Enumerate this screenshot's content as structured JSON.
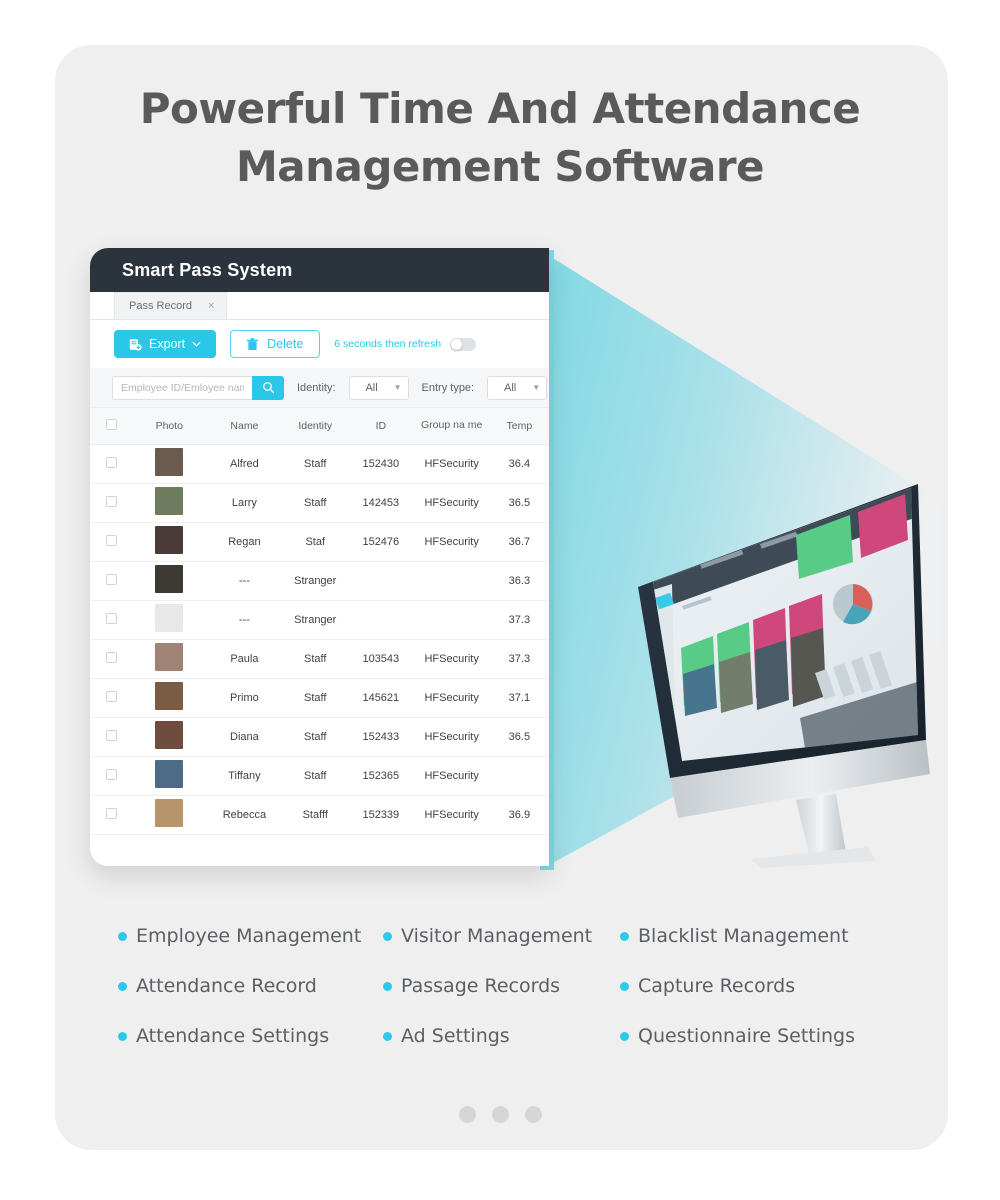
{
  "heading": {
    "line1": "Powerful Time And Attendance",
    "line2": "Management Software"
  },
  "app": {
    "title": "Smart Pass System",
    "tab": {
      "label": "Pass Record",
      "close": "×"
    },
    "toolbar": {
      "export_label": "Export",
      "export_caret": "∨",
      "delete_label": "Delete",
      "refresh_text": "6 seconds then refresh"
    },
    "filters": {
      "search_placeholder": "Employee ID/Emloyee nam",
      "identity_label": "Identity:",
      "identity_value": "All",
      "entry_label": "Entry type:",
      "entry_value": "All"
    },
    "table": {
      "columns": [
        "",
        "Photo",
        "Name",
        "Identity",
        "ID",
        "Group na me",
        "Temp"
      ],
      "rows": [
        {
          "name": "Alfred",
          "identity": "Staff",
          "id": "152430",
          "group": "HFSecurity",
          "temp": "36.4",
          "temp_state": "ok",
          "avatar": "#6b5a4e"
        },
        {
          "name": "Larry",
          "identity": "Staff",
          "id": "142453",
          "group": "HFSecurity",
          "temp": "36.5",
          "temp_state": "ok",
          "avatar": "#6f7b5f"
        },
        {
          "name": "Regan",
          "identity": "Staf",
          "id": "152476",
          "group": "HFSecurity",
          "temp": "36.7",
          "temp_state": "ok",
          "avatar": "#4a3b38"
        },
        {
          "name": "---",
          "identity": "Stranger",
          "id": "",
          "group": "",
          "temp": "36.3",
          "temp_state": "ok",
          "avatar": "#3c3a33"
        },
        {
          "name": "---",
          "identity": "Stranger",
          "id": "",
          "group": "",
          "temp": "37.3",
          "temp_state": "high",
          "avatar": "#e8e8e8"
        },
        {
          "name": "Paula",
          "identity": "Staff",
          "id": "103543",
          "group": "HFSecurity",
          "temp": "37.3",
          "temp_state": "high",
          "avatar": "#a08374"
        },
        {
          "name": "Primo",
          "identity": "Staff",
          "id": "145621",
          "group": "HFSecurity",
          "temp": "37.1",
          "temp_state": "ok",
          "avatar": "#7a5c45"
        },
        {
          "name": "Diana",
          "identity": "Staff",
          "id": "152433",
          "group": "HFSecurity",
          "temp": "36.5",
          "temp_state": "ok",
          "avatar": "#6e4c40"
        },
        {
          "name": "Tiffany",
          "identity": "Staff",
          "id": "152365",
          "group": "HFSecurity",
          "temp": "",
          "temp_state": "ok",
          "avatar": "#4d6b86"
        },
        {
          "name": "Rebecca",
          "identity": "Stafff",
          "id": "152339",
          "group": "HFSecurity",
          "temp": "36.9",
          "temp_state": "ok",
          "avatar": "#b79469"
        }
      ]
    }
  },
  "features": [
    "Employee Management",
    "Visitor Management",
    "Blacklist Management",
    "Attendance Record",
    "Passage Records",
    "Capture Records",
    "Attendance Settings",
    "Ad Settings",
    "Questionnaire Settings"
  ],
  "carousel": {
    "count": 3
  },
  "colors": {
    "accent": "#2ac7e8",
    "bullet": "#2fc8ea",
    "header_bg": "#2b333c",
    "card_bg": "#efefef",
    "page_bg": "#ffffff",
    "temp_ok": "#5bc94a",
    "temp_high": "#f16c6c",
    "identity_green": "#5bc94a",
    "heading_text": "#5a5a5a"
  }
}
